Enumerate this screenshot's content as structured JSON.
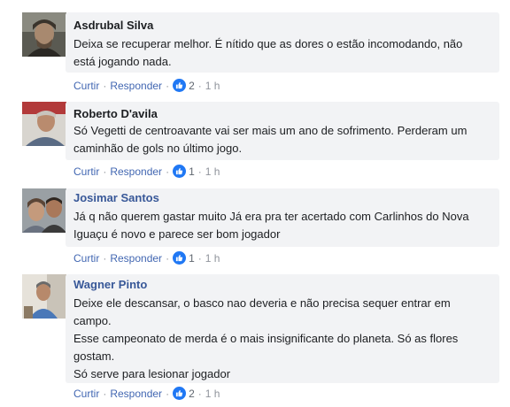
{
  "labels": {
    "like": "Curtir",
    "reply": "Responder"
  },
  "comments": [
    {
      "author": "Asdrubal Silva",
      "text": "Deixa se recuperar melhor. É nítido que as dores o estão incomodando, não está jogando nada.",
      "reactions": "2",
      "time": "1 h"
    },
    {
      "author": "Roberto D'avila",
      "text": "Só Vegetti de centroavante vai ser mais um ano de sofrimento. Perderam um caminhão de gols no último jogo.",
      "reactions": "1",
      "time": "1 h"
    },
    {
      "author": "Josimar Santos",
      "text": "Já q não querem gastar muito Já era pra ter acertado com Carlinhos do Nova Iguaçu é novo e parece ser bom jogador",
      "reactions": "1",
      "time": "1 h"
    },
    {
      "author": "Wagner Pinto",
      "text": "Deixe ele descansar, o basco nao deveria e não precisa sequer entrar em campo.\nEsse campeonato de merda é o mais insignificante do planeta. Só as flores gostam.\nSó serve para lesionar jogador",
      "reactions": "2",
      "time": "1 h"
    }
  ],
  "colors": {
    "bubble": "#f2f3f5",
    "link": "#4267b2",
    "author_link": "#385898",
    "like_icon": "#2078f4"
  },
  "icons": [
    "avatar",
    "like-icon"
  ]
}
